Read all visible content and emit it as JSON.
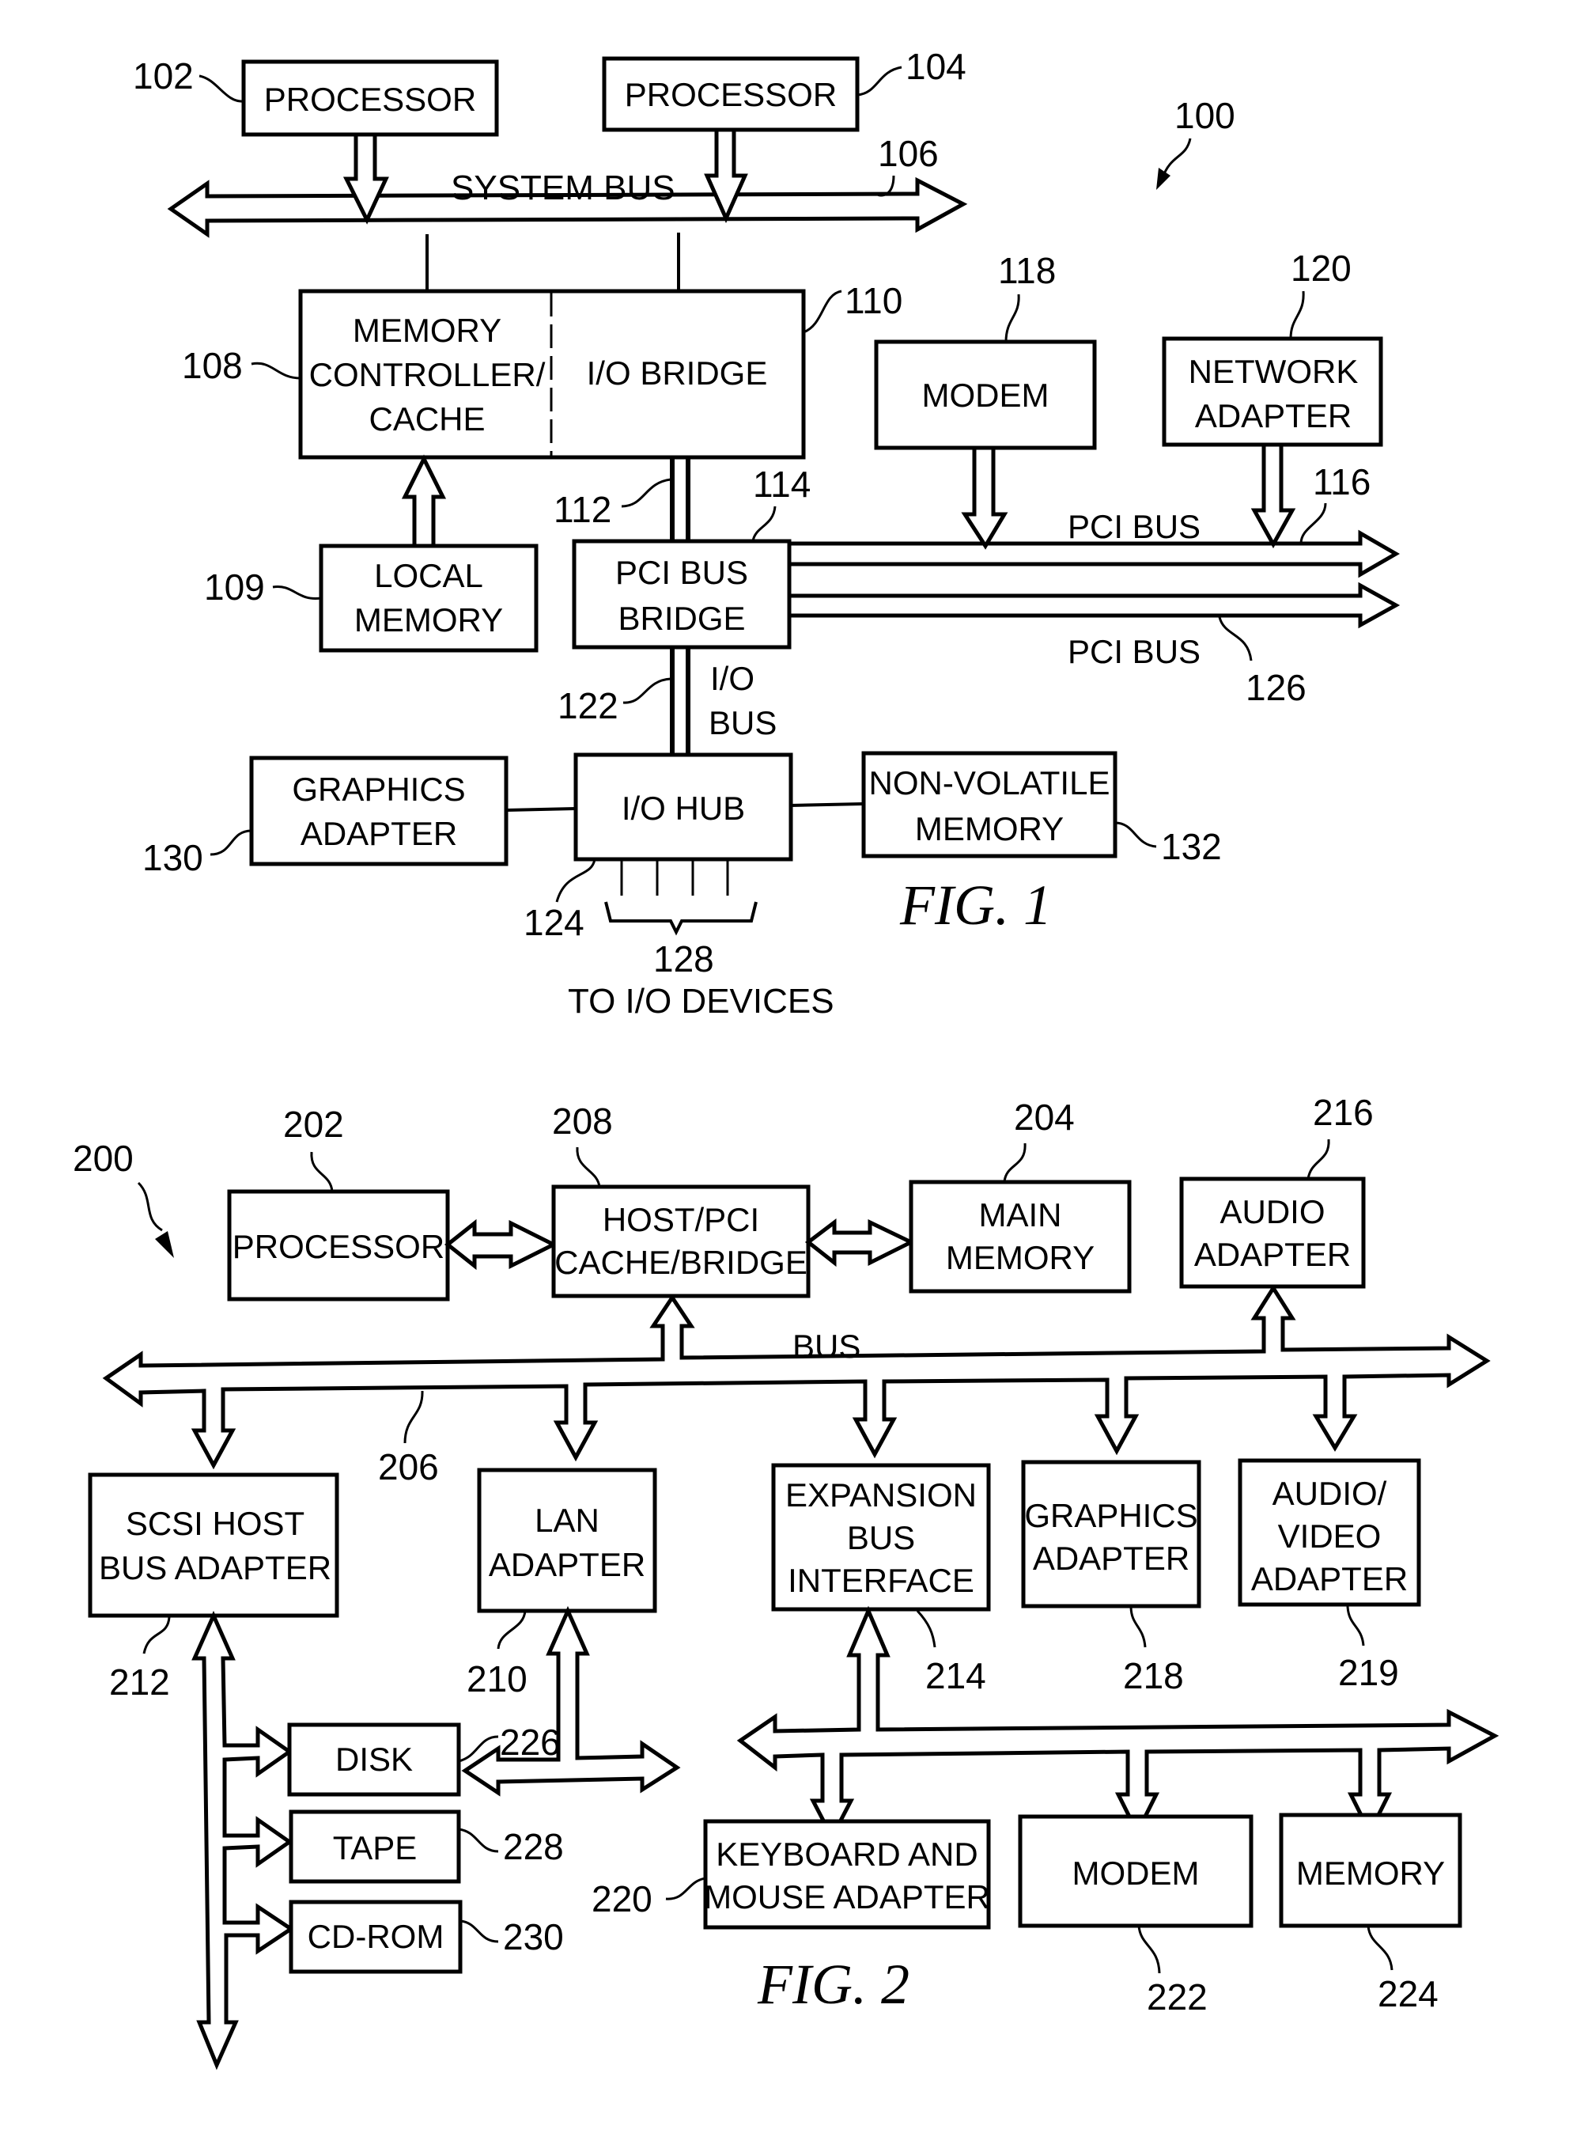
{
  "fig1": {
    "caption": "FIG. 1",
    "system_ref": "100",
    "blocks": {
      "processor_a": {
        "ref": "102",
        "lines": [
          "PROCESSOR"
        ]
      },
      "processor_b": {
        "ref": "104",
        "lines": [
          "PROCESSOR"
        ]
      },
      "memory_controller": {
        "ref": "108",
        "lines": [
          "MEMORY",
          "CONTROLLER/",
          "CACHE"
        ]
      },
      "io_bridge": {
        "ref": "110",
        "lines": [
          "I/O BRIDGE"
        ]
      },
      "local_memory": {
        "ref": "109",
        "lines": [
          "LOCAL",
          "MEMORY"
        ]
      },
      "pci_bus_bridge": {
        "ref": "114",
        "lines": [
          "PCI BUS",
          "BRIDGE"
        ]
      },
      "modem": {
        "ref": "118",
        "lines": [
          "MODEM"
        ]
      },
      "network_adapter": {
        "ref": "120",
        "lines": [
          "NETWORK",
          "ADAPTER"
        ]
      },
      "io_hub": {
        "ref": "124",
        "lines": [
          "I/O HUB"
        ]
      },
      "graphics_adapter": {
        "ref": "130",
        "lines": [
          "GRAPHICS",
          "ADAPTER"
        ]
      },
      "non_volatile_memory": {
        "ref": "132",
        "lines": [
          "NON-VOLATILE",
          "MEMORY"
        ]
      }
    },
    "buses": {
      "system_bus": {
        "ref": "106",
        "label": "SYSTEM BUS"
      },
      "link_112": {
        "ref": "112"
      },
      "pci_bus_upper": {
        "ref": "116",
        "label": "PCI BUS"
      },
      "pci_bus_lower": {
        "ref": "126",
        "label": "PCI BUS"
      },
      "io_bus": {
        "ref": "122",
        "lines": [
          "I/O",
          "BUS"
        ]
      },
      "io_devices": {
        "ref": "128",
        "label": "TO I/O DEVICES"
      }
    }
  },
  "fig2": {
    "caption": "FIG. 2",
    "system_ref": "200",
    "bus_label": "BUS",
    "blocks": {
      "processor": {
        "ref": "202",
        "lines": [
          "PROCESSOR"
        ]
      },
      "host_pci_bridge": {
        "ref": "208",
        "lines": [
          "HOST/PCI",
          "CACHE/BRIDGE"
        ]
      },
      "main_memory": {
        "ref": "204",
        "lines": [
          "MAIN",
          "MEMORY"
        ]
      },
      "audio_adapter": {
        "ref": "216",
        "lines": [
          "AUDIO",
          "ADAPTER"
        ]
      },
      "scsi_host_bus_adapter": {
        "ref": "212",
        "lines": [
          "SCSI HOST",
          "BUS ADAPTER"
        ]
      },
      "lan_adapter": {
        "ref": "210",
        "lines": [
          "LAN",
          "ADAPTER"
        ]
      },
      "expansion_bus_interface": {
        "ref": "214",
        "lines": [
          "EXPANSION",
          "BUS",
          "INTERFACE"
        ]
      },
      "graphics_adapter": {
        "ref": "218",
        "lines": [
          "GRAPHICS",
          "ADAPTER"
        ]
      },
      "audio_video_adapter": {
        "ref": "219",
        "lines": [
          "AUDIO/",
          "VIDEO",
          "ADAPTER"
        ]
      },
      "disk": {
        "ref": "226",
        "lines": [
          "DISK"
        ]
      },
      "tape": {
        "ref": "228",
        "lines": [
          "TAPE"
        ]
      },
      "cd_rom": {
        "ref": "230",
        "lines": [
          "CD-ROM"
        ]
      },
      "keyboard_mouse_adapter": {
        "ref": "220",
        "lines": [
          "KEYBOARD AND",
          "MOUSE ADAPTER"
        ]
      },
      "modem": {
        "ref": "222",
        "lines": [
          "MODEM"
        ]
      },
      "memory": {
        "ref": "224",
        "lines": [
          "MEMORY"
        ]
      }
    },
    "buses": {
      "main_bus": {
        "ref": "206"
      }
    }
  }
}
